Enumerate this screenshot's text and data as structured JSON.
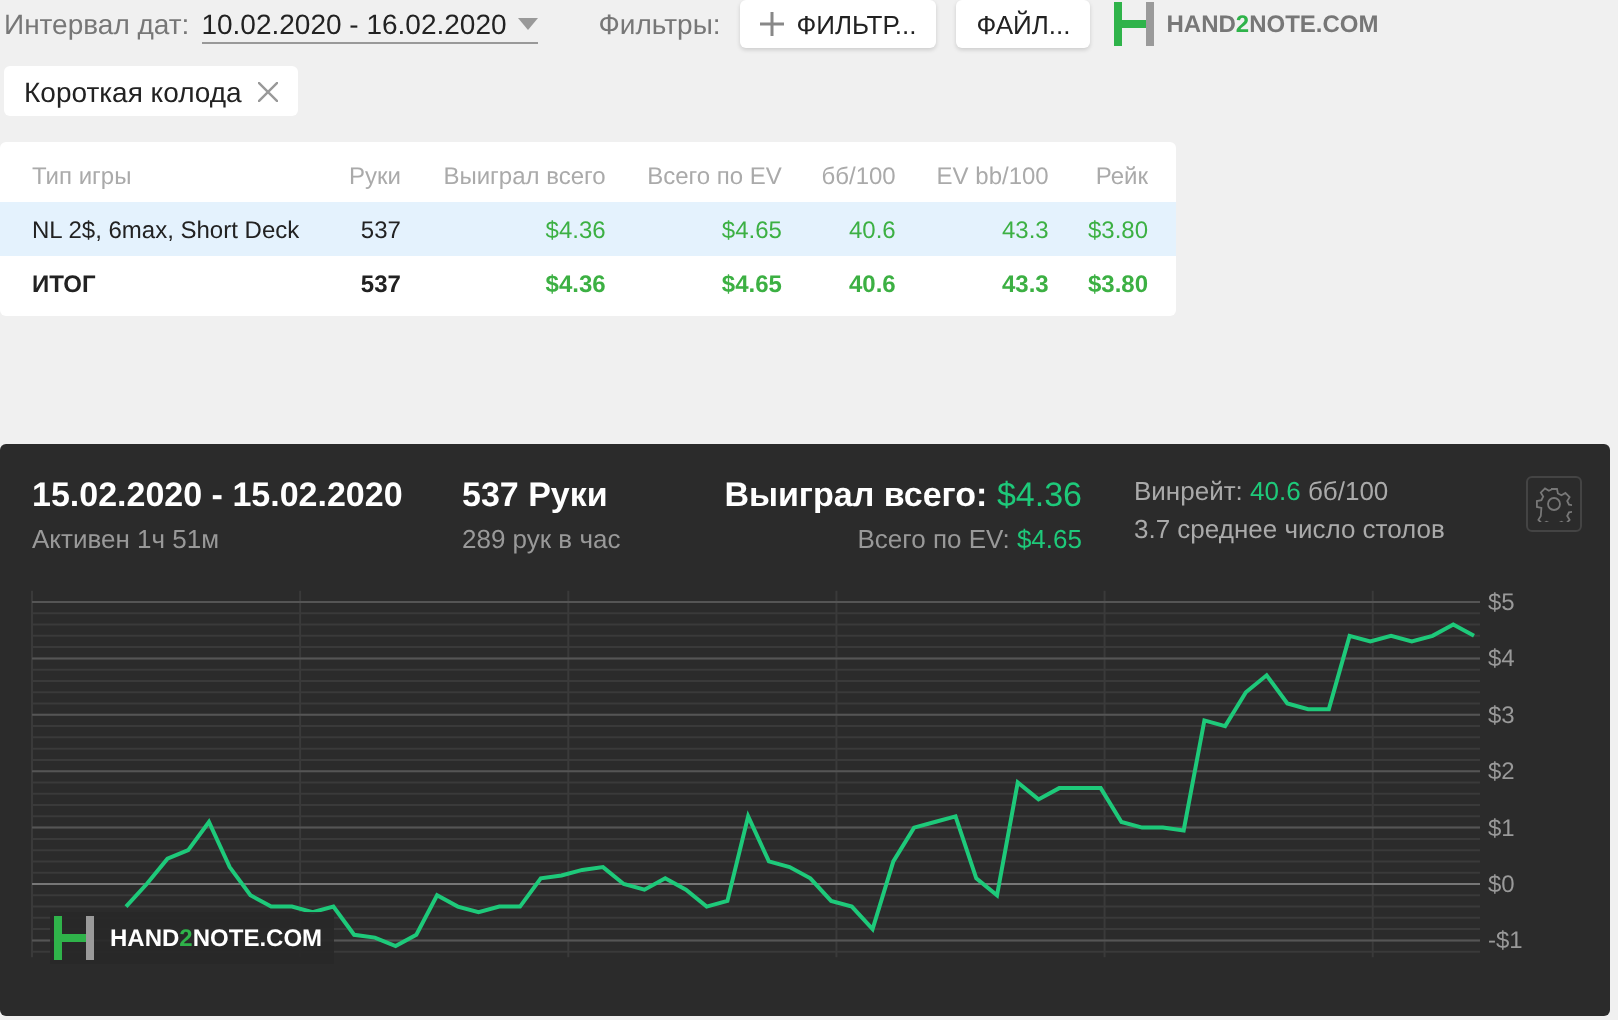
{
  "toolbar": {
    "date_label": "Интервал дат:",
    "date_value": "10.02.2020 - 16.02.2020",
    "filters_label": "Фильтры:",
    "buttons": [
      {
        "label": "ФИЛЬТР...",
        "kind": "add"
      },
      {
        "label": "ФАЙЛ...",
        "kind": "plain"
      }
    ],
    "logo": {
      "before": "HAND",
      "accent": "2",
      "after": "NOTE.COM"
    }
  },
  "chips": [
    {
      "label": "Короткая колода"
    }
  ],
  "table": {
    "columns": [
      {
        "label": "Тип игры",
        "kind": "label"
      },
      {
        "label": "Руки",
        "kind": "count"
      },
      {
        "label": "Выиграл всего",
        "kind": "result"
      },
      {
        "label": "Всего по EV",
        "kind": "result"
      },
      {
        "label": "бб/100",
        "kind": "result"
      },
      {
        "label": "EV bb/100",
        "kind": "result"
      },
      {
        "label": "Рейк",
        "kind": "result"
      }
    ],
    "rows": [
      {
        "cells": [
          "NL 2$, 6max, Short Deck",
          "537",
          "$4.36",
          "$4.65",
          "40.6",
          "43.3",
          "$3.80"
        ],
        "selected": true,
        "total": false
      },
      {
        "cells": [
          "ИТОГ",
          "537",
          "$4.36",
          "$4.65",
          "40.6",
          "43.3",
          "$3.80"
        ],
        "selected": false,
        "total": true
      }
    ]
  },
  "session": {
    "period": "15.02.2020 - 15.02.2020",
    "active": "Активен 1ч 51м",
    "hands": "537 Руки",
    "hands_rate": "289 рук в час",
    "won_label": "Выиграл всего:",
    "won_value": "$4.36",
    "ev_label": "Всего по EV:",
    "ev_value": "$4.65",
    "winrate_label": "Винрейт:",
    "winrate_value": "40.6",
    "winrate_unit": "бб/100",
    "tables": "3.7 среднее число столов",
    "chart_data": {
      "type": "line",
      "grid": true,
      "ylim": [
        -1.3,
        5.2
      ],
      "yticks": [
        {
          "value": 5,
          "label": "$5"
        },
        {
          "value": 4,
          "label": "$4"
        },
        {
          "value": 3,
          "label": "$3"
        },
        {
          "value": 2,
          "label": "$2"
        },
        {
          "value": 1,
          "label": "$1"
        },
        {
          "value": 0,
          "label": "$0"
        },
        {
          "value": -1,
          "label": "-$1"
        }
      ],
      "series": [
        {
          "color": "#1ec97a",
          "values": [
            -0.4,
            0,
            0.45,
            0.6,
            1.1,
            0.3,
            -0.2,
            -0.4,
            -0.4,
            -0.5,
            -0.4,
            -0.9,
            -0.95,
            -1.1,
            -0.9,
            -0.2,
            -0.4,
            -0.5,
            -0.4,
            -0.4,
            0.1,
            0.15,
            0.25,
            0.3,
            0,
            -0.1,
            0.1,
            -0.1,
            -0.4,
            -0.3,
            1.2,
            0.4,
            0.3,
            0.1,
            -0.3,
            -0.4,
            -0.8,
            0.4,
            1.0,
            1.1,
            1.2,
            0.1,
            -0.2,
            1.8,
            1.5,
            1.7,
            1.7,
            1.7,
            1.1,
            1.0,
            1.0,
            0.95,
            2.9,
            2.8,
            3.4,
            3.7,
            3.2,
            3.1,
            3.1,
            4.4,
            4.3,
            4.4,
            4.3,
            4.4,
            4.6,
            4.4
          ]
        }
      ]
    },
    "watermark": {
      "before": "HAND",
      "accent": "2",
      "after": "NOTE.COM"
    }
  }
}
